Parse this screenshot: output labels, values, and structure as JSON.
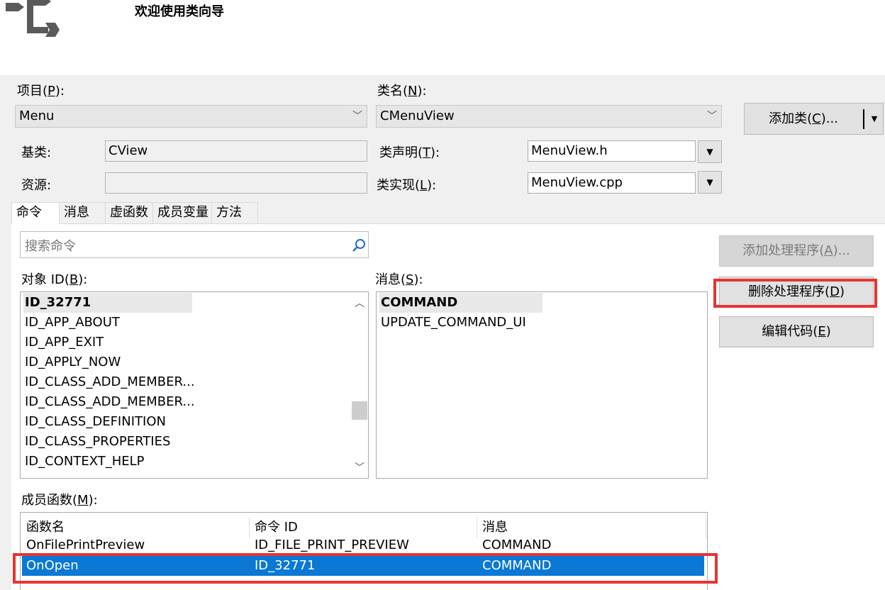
{
  "header": {
    "title": "欢迎使用类向导"
  },
  "project": {
    "label_pre": "项目(",
    "label_key": "P",
    "label_post": "):",
    "value": "Menu"
  },
  "classname": {
    "label_pre": "类名(",
    "label_key": "N",
    "label_post": "):",
    "value": "CMenuView"
  },
  "add_class": {
    "label_pre": "添加类(",
    "label_key": "C",
    "label_post": ")...",
    "dropdown_glyph": "▼"
  },
  "base_class": {
    "label": "基类:",
    "value": "CView"
  },
  "resource": {
    "label": "资源:",
    "value": ""
  },
  "class_decl": {
    "label_pre": "类声明(",
    "label_key": "T",
    "label_post": "):",
    "value": "MenuView.h",
    "btn_glyph": "▼"
  },
  "class_impl": {
    "label_pre": "类实现(",
    "label_key": "L",
    "label_post": "):",
    "value": "MenuView.cpp",
    "btn_glyph": "▼"
  },
  "tabs": [
    "命令",
    "消息",
    "虚函数",
    "成员变量",
    "方法"
  ],
  "search": {
    "placeholder": "搜索命令"
  },
  "object_ids": {
    "label_pre": "对象 ID(",
    "label_key": "B",
    "label_post": "):",
    "items": [
      "ID_32771",
      "ID_APP_ABOUT",
      "ID_APP_EXIT",
      "ID_APPLY_NOW",
      "ID_CLASS_ADD_MEMBER...",
      "ID_CLASS_ADD_MEMBER...",
      "ID_CLASS_DEFINITION",
      "ID_CLASS_PROPERTIES",
      "ID_CONTEXT_HELP"
    ],
    "selected_index": 0,
    "scroll_up": "︿",
    "scroll_down": "﹀"
  },
  "messages": {
    "label_pre": "消息(",
    "label_key": "S",
    "label_post": "):",
    "items": [
      "COMMAND",
      "UPDATE_COMMAND_UI"
    ],
    "selected_index": 0
  },
  "buttons": {
    "add_handler": {
      "pre": "添加处理程序(",
      "key": "A",
      "post": ")...",
      "enabled": false
    },
    "delete_handler": {
      "pre": "删除处理程序(",
      "key": "D",
      "post": ")",
      "enabled": true
    },
    "edit_code": {
      "pre": "编辑代码(",
      "key": "E",
      "post": ")",
      "enabled": true
    }
  },
  "member_functions": {
    "label_pre": "成员函数(",
    "label_key": "M",
    "label_post": "):",
    "columns": [
      "函数名",
      "命令 ID",
      "消息"
    ],
    "rows": [
      [
        "OnFilePrintPreview",
        "ID_FILE_PRINT_PREVIEW",
        "COMMAND"
      ],
      [
        "OnOpen",
        "ID_32771",
        "COMMAND"
      ]
    ],
    "selected_index": 1
  },
  "colors": {
    "highlight_red": "#e63434",
    "selection_blue": "#0a78d4"
  }
}
